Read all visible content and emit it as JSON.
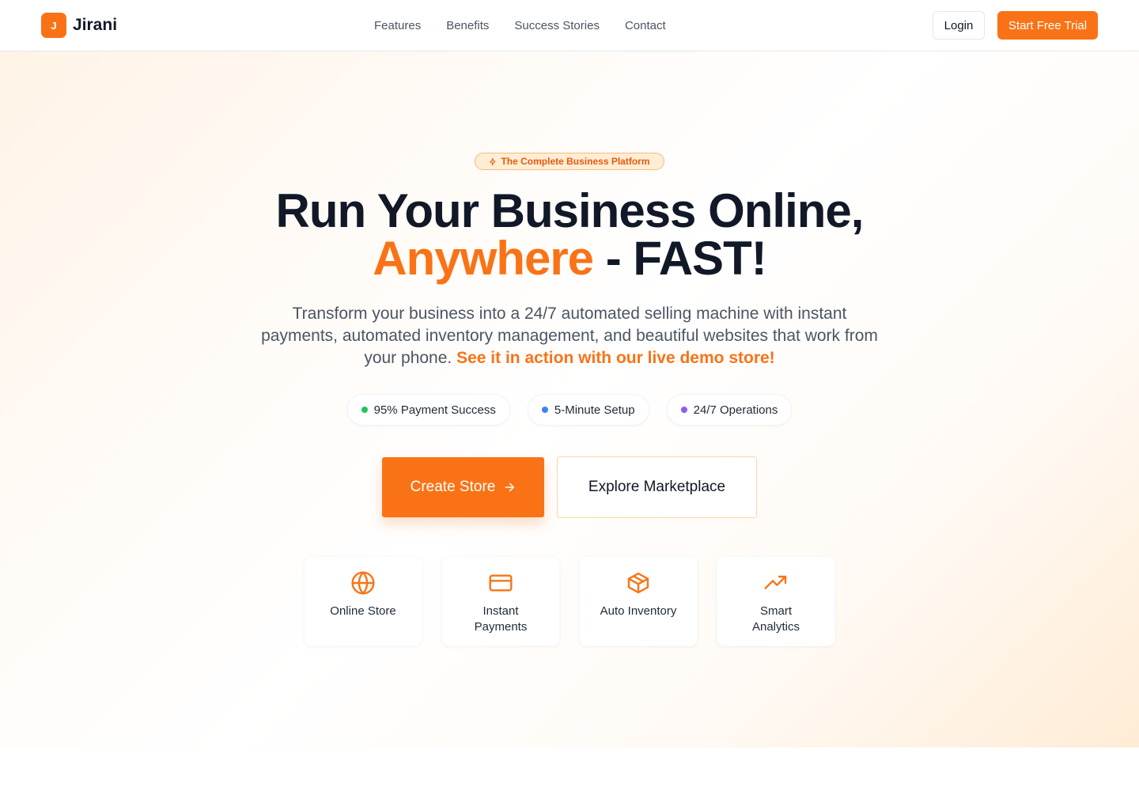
{
  "header": {
    "logo_mark": "J",
    "logo_text": "Jirani",
    "nav": [
      "Features",
      "Benefits",
      "Success Stories",
      "Contact"
    ],
    "login": "Login",
    "trial": "Start Free Trial"
  },
  "hero": {
    "badge": "The Complete Business Platform",
    "headline_line1": "Run Your Business Online,",
    "headline_accent": "Anywhere",
    "headline_rest": " - FAST!",
    "subtitle": "Transform your business into a 24/7 automated selling machine with instant payments, automated inventory management, and beautiful websites that work from your phone.",
    "subtitle_highlight": "See it in action with our live demo store!",
    "stats": [
      {
        "label": "95% Payment Success",
        "color": "#22c55e"
      },
      {
        "label": "5-Minute Setup",
        "color": "#3b82f6"
      },
      {
        "label": "24/7 Operations",
        "color": "#8b5cf6"
      }
    ],
    "create_store": "Create Store",
    "explore": "Explore Marketplace",
    "features": [
      {
        "label": "Online Store",
        "icon": "globe-icon"
      },
      {
        "label": "Instant Payments",
        "icon": "credit-card-icon"
      },
      {
        "label": "Auto Inventory",
        "icon": "package-icon"
      },
      {
        "label": "Smart Analytics",
        "icon": "trending-up-icon"
      }
    ]
  },
  "colors": {
    "accent": "#f97316",
    "text": "#111827"
  }
}
